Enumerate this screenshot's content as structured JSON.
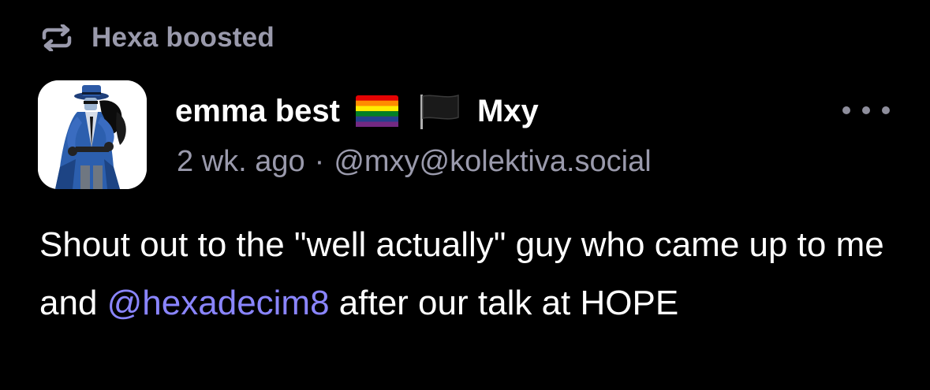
{
  "boost": {
    "icon": "repeat-icon",
    "label": "Hexa boosted"
  },
  "author": {
    "avatar": "avatar",
    "name_part1": "emma best",
    "flags": [
      "rainbow-flag-icon",
      "black-flag-icon"
    ],
    "name_part2": "Mxy",
    "time_ago": "2 wk. ago",
    "separator": "·",
    "handle": "@mxy@kolektiva.social"
  },
  "menu": {
    "icon": "more-options-icon"
  },
  "post": {
    "text_before": "Shout out to the \"well actually\" guy who came up to me and ",
    "mention": "@hexadecim8",
    "text_after": " after our talk at HOPE"
  },
  "colors": {
    "background": "#000000",
    "text": "#ffffff",
    "muted": "#9a9aac",
    "mention": "#8a85ff"
  }
}
